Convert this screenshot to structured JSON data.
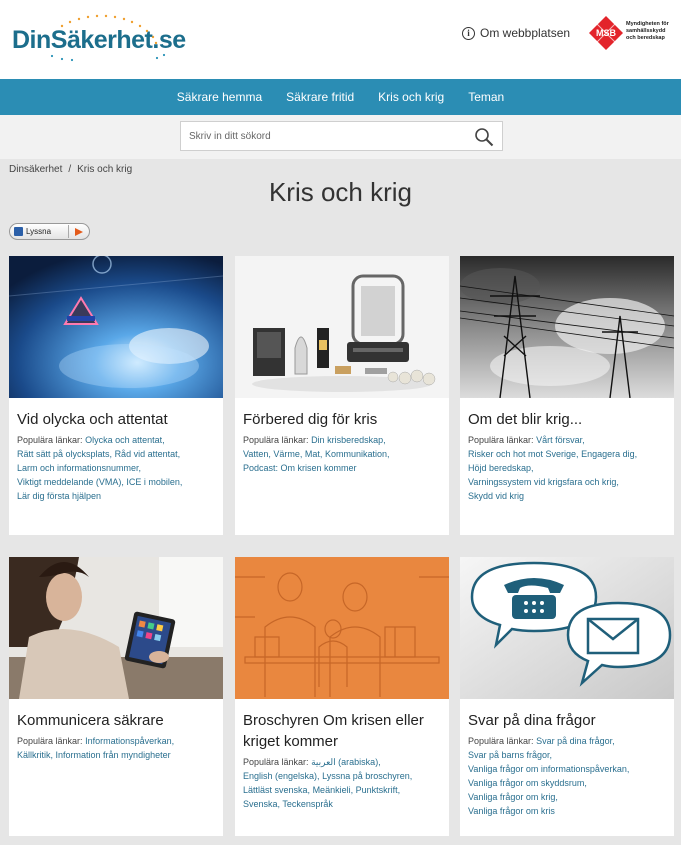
{
  "header": {
    "logo": "DinSäkerhet.se",
    "about_label": "Om webbplatsen",
    "msb_badge": "MSB",
    "msb_lines": [
      "Myndigheten för",
      "samhällsskydd",
      "och beredskap"
    ]
  },
  "nav": {
    "items": [
      "Säkrare hemma",
      "Säkrare fritid",
      "Kris och krig",
      "Teman"
    ]
  },
  "search": {
    "placeholder": "Skriv in ditt sökord"
  },
  "breadcrumb": {
    "home": "Dinsäkerhet",
    "separator": "/",
    "current": "Kris och krig"
  },
  "page_title": "Kris och krig",
  "listen_label": "Lyssna",
  "popular_label": "Populära länkar:",
  "cards": [
    {
      "title": "Vid olycka och attentat",
      "links": [
        "Olycka och attentat,",
        "Rätt sätt på olycksplats,",
        "Råd vid attentat,",
        "Larm och informationsnummer,",
        "Viktigt meddelande (VMA),",
        "ICE i mobilen,",
        "Lär dig första hjälpen"
      ]
    },
    {
      "title": "Förbered dig för kris",
      "links": [
        "Din krisberedskap,",
        "Vatten,",
        "Värme,",
        "Mat,",
        "Kommunikation,",
        "Podcast: Om krisen kommer"
      ]
    },
    {
      "title": "Om det blir krig...",
      "links": [
        "Vårt försvar,",
        "Risker och hot mot Sverige,",
        "Engagera dig,",
        "Höjd beredskap,",
        "Varningssystem vid krigsfara och krig,",
        "Skydd vid krig"
      ]
    },
    {
      "title": "Kommunicera säkrare",
      "links": [
        "Informationspåverkan,",
        "Källkritik,",
        "Information från myndigheter"
      ]
    },
    {
      "title": "Broschyren Om krisen eller kriget kommer",
      "links": [
        "العربية (arabiska),",
        "English (engelska),",
        "Lyssna på broschyren,",
        "Lättläst svenska,",
        "Meänkieli,",
        "Punktskrift,",
        "Svenska,",
        "Teckenspråk"
      ]
    },
    {
      "title": "Svar på dina frågor",
      "links": [
        "Svar på dina frågor,",
        "Svar på barns frågor,",
        "Vanliga frågor om informationspåverkan,",
        "Vanliga frågor om skyddsrum,",
        "Vanliga frågor om krig,",
        "Vanliga frågor om kris"
      ]
    }
  ],
  "colors": {
    "nav": "#2b8db4",
    "logo": "#1c6e8c",
    "link": "#2a6f8f",
    "msb_red": "#e3242b"
  }
}
